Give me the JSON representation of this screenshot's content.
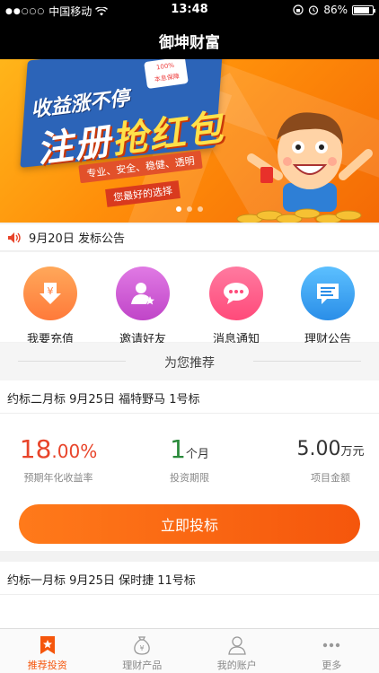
{
  "status_bar": {
    "signal": "●●○○○",
    "carrier": "中国移动",
    "time": "13:48",
    "battery": "86%",
    "battery_level": 0.86
  },
  "nav": {
    "title": "御坤财富"
  },
  "banner": {
    "subtitle": "收益涨不停",
    "title_part1": "注册",
    "title_part2": "抢红包",
    "features": "专业、安全、稳健、透明",
    "slogan": "您最好的选择",
    "badge_line1": "100%",
    "badge_line2": "本息保障",
    "slides": 3,
    "active_slide": 0
  },
  "notice": {
    "text": "9月20日 发标公告",
    "icon": "speaker-icon"
  },
  "quick_actions": [
    {
      "label": "我要充值",
      "icon": "yen-download-icon",
      "color": "#ff8a4a"
    },
    {
      "label": "邀请好友",
      "icon": "person-star-icon",
      "color": "#d45ad8"
    },
    {
      "label": "消息通知",
      "icon": "chat-bubble-icon",
      "color": "#ff5a8a"
    },
    {
      "label": "理财公告",
      "icon": "notice-doc-icon",
      "color": "#3fa7f0"
    }
  ],
  "recommend": {
    "header": "为您推荐"
  },
  "products": [
    {
      "name": "约标二月标 9月25日 福特野马 1号标",
      "rate_int": "18",
      "rate_dec": ".00%",
      "rate_caption": "预期年化收益率",
      "term_value": "1",
      "term_unit": "个月",
      "term_caption": "投资期限",
      "amount_value": "5.00",
      "amount_unit": "万元",
      "amount_caption": "项目金额",
      "button": "立即投标"
    },
    {
      "name": "约标一月标 9月25日 保时捷 11号标"
    }
  ],
  "tabbar": [
    {
      "label": "推荐投资",
      "icon": "star-ribbon-icon",
      "active": true
    },
    {
      "label": "理财产品",
      "icon": "money-bag-icon",
      "active": false
    },
    {
      "label": "我的账户",
      "icon": "user-icon",
      "active": false
    },
    {
      "label": "更多",
      "icon": "more-dots-icon",
      "active": false
    }
  ],
  "colors": {
    "accent": "#f5560c",
    "rate": "#e8442a",
    "term": "#2a8a3a"
  }
}
